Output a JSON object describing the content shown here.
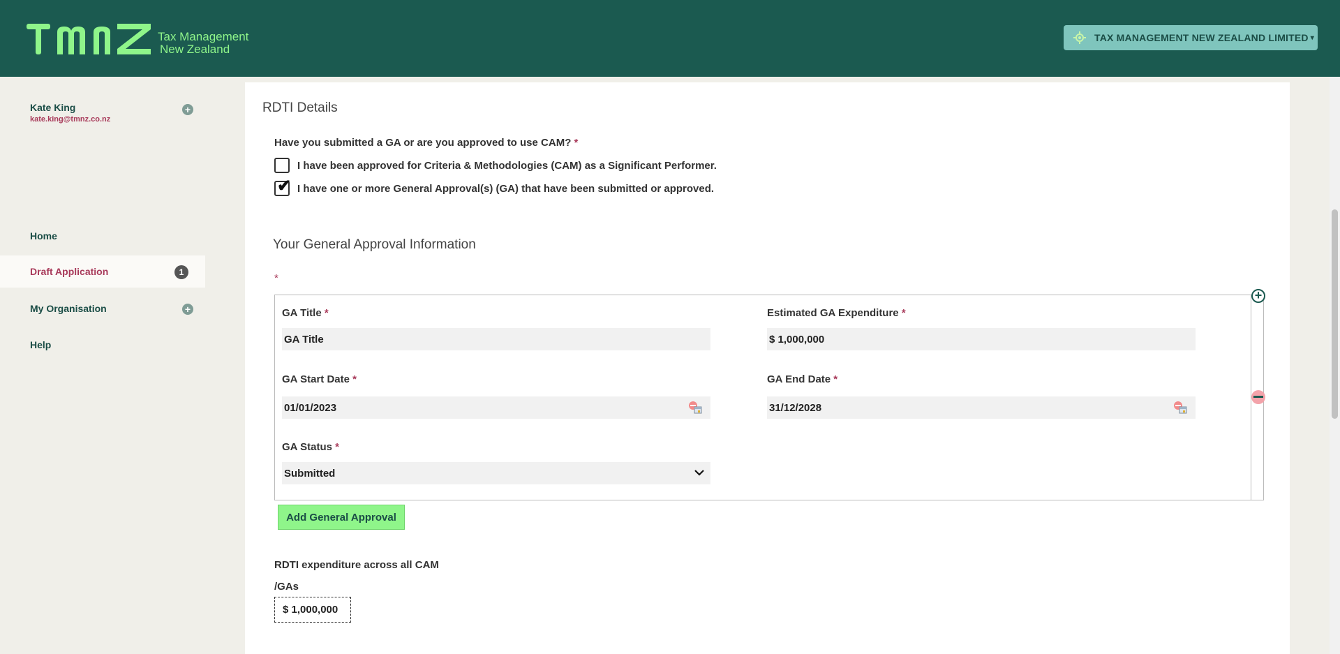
{
  "header": {
    "logo_mark_text": "TMNZ",
    "logo_line1": "Tax Management",
    "logo_line2": "New Zealand",
    "org_selector_label": "TAX MANAGEMENT NEW ZEALAND LIMITED",
    "brand_color": "#1b5a50",
    "accent_color": "#8ff58a"
  },
  "sidebar": {
    "user_name": "Kate King",
    "user_email": "kate.king@tmnz.co.nz",
    "items": [
      {
        "label": "Home"
      },
      {
        "label": "Draft Application",
        "badge": "1",
        "active": true
      },
      {
        "label": "My Organisation"
      },
      {
        "label": "Help"
      }
    ]
  },
  "main": {
    "section_title": "RDTI Details",
    "question": "Have you submitted a GA or are you approved to use CAM?",
    "required_mark": "*",
    "options": [
      {
        "label": "I have been approved for Criteria & Methodologies (CAM) as a Significant Performer.",
        "checked": false
      },
      {
        "label": "I have one or more General Approval(s) (GA) that have been submitted or approved.",
        "checked": true
      }
    ],
    "ga_section_title": "Your General Approval Information",
    "ga": {
      "title_label": "GA Title",
      "title_value": "GA Title",
      "expenditure_label": "Estimated GA Expenditure",
      "expenditure_value": "$ 1,000,000",
      "start_label": "GA Start Date",
      "start_value": "01/01/2023",
      "end_label": "GA End Date",
      "end_value": "31/12/2028",
      "status_label": "GA Status",
      "status_value": "Submitted"
    },
    "add_button": "Add General Approval",
    "expenditure_total_label_line1": "RDTI expenditure across all CAM",
    "expenditure_total_label_line2": "/GAs",
    "expenditure_total_value": "$ 1,000,000"
  }
}
